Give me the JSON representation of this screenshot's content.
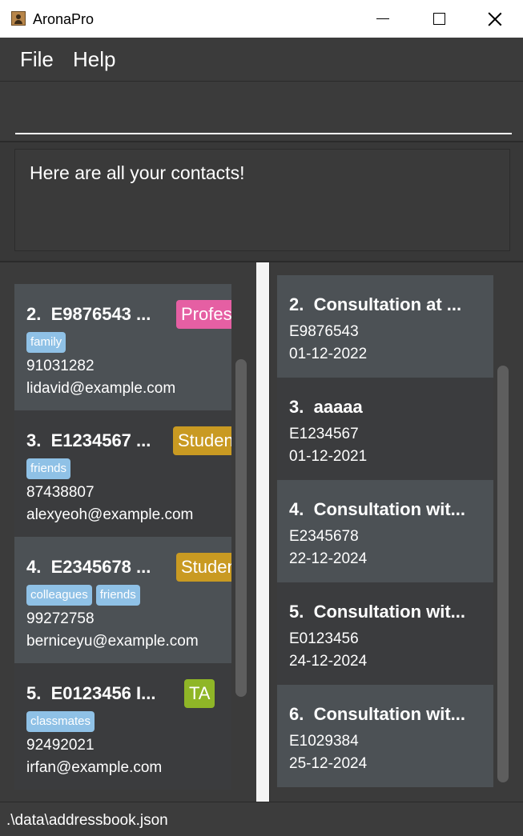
{
  "window": {
    "title": "AronaPro",
    "icon": "contact-book-icon"
  },
  "menu": {
    "file": "File",
    "help": "Help"
  },
  "command": {
    "value": "",
    "placeholder": ""
  },
  "result": {
    "message": "Here are all your contacts!"
  },
  "persons": [
    {
      "index": "2.",
      "title": "E9876543 ...",
      "role": "Profes",
      "role_color": "#e55fa3",
      "tags": [
        "family"
      ],
      "phone": "91031282",
      "email": "lidavid@example.com"
    },
    {
      "index": "3.",
      "title": "E1234567 ...",
      "role": "Studen",
      "role_color": "#c99a22",
      "tags": [
        "friends"
      ],
      "phone": "87438807",
      "email": "alexyeoh@example.com"
    },
    {
      "index": "4.",
      "title": "E2345678 ...",
      "role": "Studen",
      "role_color": "#c99a22",
      "tags": [
        "colleagues",
        "friends"
      ],
      "phone": "99272758",
      "email": "berniceyu@example.com"
    },
    {
      "index": "5.",
      "title": "E0123456 I...",
      "role": "TA",
      "role_color": "#8fb627",
      "tags": [
        "classmates"
      ],
      "phone": "92492021",
      "email": "irfan@example.com"
    }
  ],
  "consultations": [
    {
      "index": "2.",
      "title": "Consultation at ...",
      "id": "E9876543",
      "date": "01-12-2022"
    },
    {
      "index": "3.",
      "title": "aaaaa",
      "id": "E1234567",
      "date": "01-12-2021"
    },
    {
      "index": "4.",
      "title": "Consultation wit...",
      "id": "E2345678",
      "date": "22-12-2024"
    },
    {
      "index": "5.",
      "title": "Consultation wit...",
      "id": "E0123456",
      "date": "24-12-2024"
    },
    {
      "index": "6.",
      "title": "Consultation wit...",
      "id": "E1029384",
      "date": "25-12-2024"
    }
  ],
  "status": {
    "path": ".\\data\\addressbook.json"
  },
  "colors": {
    "card_light": "#4c5155",
    "card_dark": "#3b3c3e",
    "tag": "#8fc1e6",
    "background": "#3c3c3c"
  }
}
